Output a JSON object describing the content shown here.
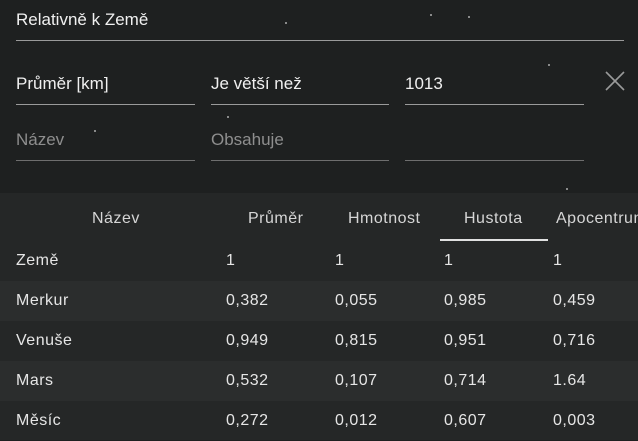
{
  "filters": {
    "reference": "Relativně k Země",
    "row1": {
      "property": "Průměr [km]",
      "operator": "Je větší než",
      "value": "1013"
    },
    "row2": {
      "property_placeholder": "Název",
      "operator_placeholder": "Obsahuje",
      "value": ""
    }
  },
  "table": {
    "columns": [
      "Název",
      "Průměr",
      "Hmotnost",
      "Hustota",
      "Apocentrum"
    ],
    "rows": [
      {
        "name": "Země",
        "prumer": "1",
        "hmotnost": "1",
        "hustota": "1",
        "apocentrum": "1"
      },
      {
        "name": "Merkur",
        "prumer": "0,382",
        "hmotnost": "0,055",
        "hustota": "0,985",
        "apocentrum": "0,459"
      },
      {
        "name": "Venuše",
        "prumer": "0,949",
        "hmotnost": "0,815",
        "hustota": "0,951",
        "apocentrum": "0,716"
      },
      {
        "name": "Mars",
        "prumer": "0,532",
        "hmotnost": "0,107",
        "hustota": "0,714",
        "apocentrum": "1.64"
      },
      {
        "name": "Měsíc",
        "prumer": "0,272",
        "hmotnost": "0,012",
        "hustota": "0,607",
        "apocentrum": "0,003"
      }
    ],
    "sorted_column": "Hustota"
  }
}
